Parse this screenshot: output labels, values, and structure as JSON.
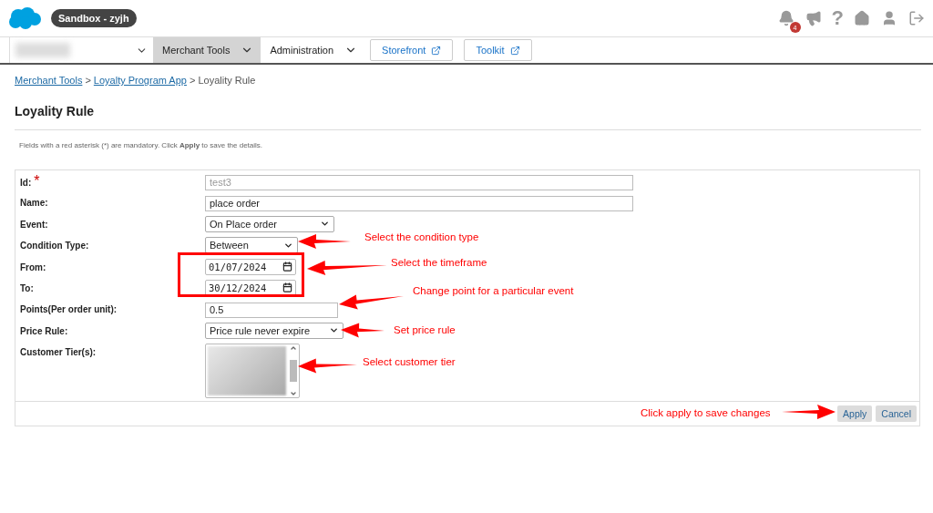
{
  "header": {
    "sandbox_label": "Sandbox - zyjh",
    "notification_count": "4",
    "help_glyph": "?"
  },
  "nav": {
    "menus": [
      {
        "label": "Merchant Tools",
        "selected": true
      },
      {
        "label": "Administration",
        "selected": false
      }
    ],
    "external_links": [
      "Storefront",
      "Toolkit"
    ]
  },
  "breadcrumb": {
    "links": [
      "Merchant Tools",
      "Loyalty Program App"
    ],
    "current": "Loyality Rule"
  },
  "breadcrumb_separator": ">",
  "title": "Loyality Rule",
  "note": "Fields with a red asterisk (*) are mandatory. Click **Apply** to save the details.",
  "form": {
    "fields": [
      {
        "label": "Id:",
        "required_mark": "*",
        "kind": "text",
        "value": "test3",
        "disabled": true
      },
      {
        "label": "Name:",
        "kind": "text",
        "value": "place order",
        "disabled": false
      },
      {
        "label": "Event:",
        "kind": "select",
        "value": "On Place order"
      },
      {
        "label": "Condition Type:",
        "kind": "select",
        "value": "Between"
      },
      {
        "label": "From:",
        "kind": "date",
        "value": "01/07/2024"
      },
      {
        "label": "To:",
        "kind": "date",
        "value": "30/12/2024"
      },
      {
        "label": "Points(Per order unit):",
        "kind": "text",
        "value": "0.5",
        "disabled": false
      },
      {
        "label": "Price Rule:",
        "kind": "select",
        "value": "Price rule never expire"
      },
      {
        "label": "Customer Tier(s):",
        "kind": "listbox"
      }
    ],
    "buttons": [
      "Apply",
      "Cancel"
    ]
  },
  "annotations": [
    "Select the condition type",
    "Select the timeframe",
    "Change point for a particular event",
    "Set price rule",
    "Select customer tier",
    "Click apply to save changes"
  ]
}
